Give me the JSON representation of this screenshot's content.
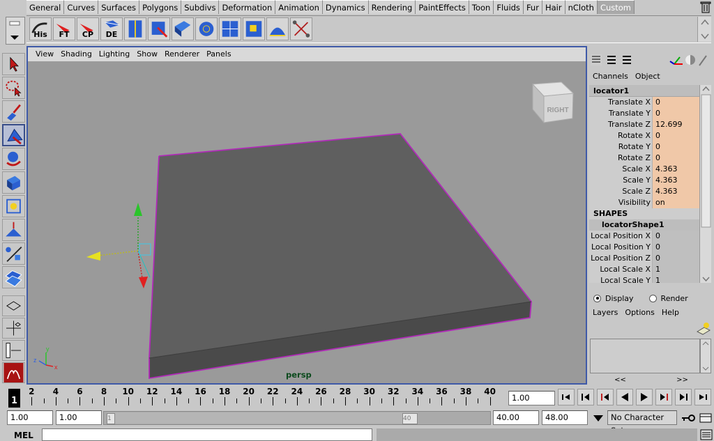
{
  "shelf": {
    "tabs": [
      "General",
      "Curves",
      "Surfaces",
      "Polygons",
      "Subdivs",
      "Deformation",
      "Animation",
      "Dynamics",
      "Rendering",
      "PaintEffects",
      "Toon",
      "Fluids",
      "Fur",
      "Hair",
      "nCloth",
      "Custom"
    ],
    "active_tab": "Custom",
    "buttons": [
      {
        "label": "His",
        "icon": "history-icon"
      },
      {
        "label": "FT",
        "icon": "freeze-transform-icon"
      },
      {
        "label": "CP",
        "icon": "center-pivot-icon"
      },
      {
        "label": "DE",
        "icon": "delete-edges-icon"
      },
      {
        "label": "",
        "icon": "uv-layout-icon"
      },
      {
        "label": "",
        "icon": "uv-select-icon"
      },
      {
        "label": "",
        "icon": "cube-icon"
      },
      {
        "label": "",
        "icon": "sphere-mesh-icon"
      },
      {
        "label": "",
        "icon": "uv-map-icon"
      },
      {
        "label": "",
        "icon": "grid-select-icon"
      },
      {
        "label": "",
        "icon": "curved-grid-icon"
      },
      {
        "label": "",
        "icon": "node-editor-icon"
      }
    ]
  },
  "toolbox": [
    "select-tool-icon",
    "lasso-tool-icon",
    "paint-select-icon",
    "move-tool-icon",
    "rotate-tool-icon",
    "scale-tool-icon",
    "universal-manip-icon",
    "soft-mod-icon",
    "show-manip-icon",
    "last-tool-icon"
  ],
  "layout_buttons": [
    "single-pane-layout-icon",
    "four-pane-layout-icon",
    "outliner-layout-icon",
    "maya-logo-icon"
  ],
  "viewport": {
    "menus": [
      "View",
      "Shading",
      "Lighting",
      "Show",
      "Renderer",
      "Panels"
    ],
    "camera": "persp",
    "view_cube_label": "RIGHT",
    "axis_labels": [
      "y",
      "z",
      "x"
    ],
    "colors": {
      "wire_highlight": "#b02ab8",
      "mesh": "#5e5e5e",
      "background": "#9a9a9a"
    }
  },
  "channel_box": {
    "menus": [
      "Channels",
      "Object"
    ],
    "node": "locator1",
    "attributes": [
      {
        "name": "Translate X",
        "value": "0"
      },
      {
        "name": "Translate Y",
        "value": "0"
      },
      {
        "name": "Translate Z",
        "value": "12.699"
      },
      {
        "name": "Rotate X",
        "value": "0"
      },
      {
        "name": "Rotate Y",
        "value": "0"
      },
      {
        "name": "Rotate Z",
        "value": "0"
      },
      {
        "name": "Scale X",
        "value": "4.363"
      },
      {
        "name": "Scale Y",
        "value": "4.363"
      },
      {
        "name": "Scale Z",
        "value": "4.363"
      },
      {
        "name": "Visibility",
        "value": "on"
      }
    ],
    "shapes_header": "SHAPES",
    "shape_node": "locatorShape1",
    "shape_attributes": [
      {
        "name": "Local Position X",
        "value": "0"
      },
      {
        "name": "Local Position Y",
        "value": "0"
      },
      {
        "name": "Local Position Z",
        "value": "0"
      },
      {
        "name": "Local Scale X",
        "value": "1"
      },
      {
        "name": "Local Scale Y",
        "value": "1"
      }
    ]
  },
  "layer_editor": {
    "mode_display": "Display",
    "mode_render": "Render",
    "menus": [
      "Layers",
      "Options",
      "Help"
    ],
    "scroll_left": "<<",
    "scroll_right": ">>"
  },
  "time_slider": {
    "tick_labels": [
      "2",
      "4",
      "6",
      "8",
      "10",
      "12",
      "14",
      "16",
      "18",
      "20",
      "22",
      "24",
      "26",
      "28",
      "30",
      "32",
      "34",
      "36",
      "38",
      "40"
    ],
    "current_frame": "1",
    "current_time_field": "1.00"
  },
  "range_slider": {
    "start_time": "1.00",
    "playback_start": "1.00",
    "handle_start": "1",
    "handle_end": "40",
    "playback_end": "40.00",
    "end_time": "48.00",
    "character_set": "No Character Set"
  },
  "command_line": {
    "label": "MEL",
    "value": ""
  }
}
